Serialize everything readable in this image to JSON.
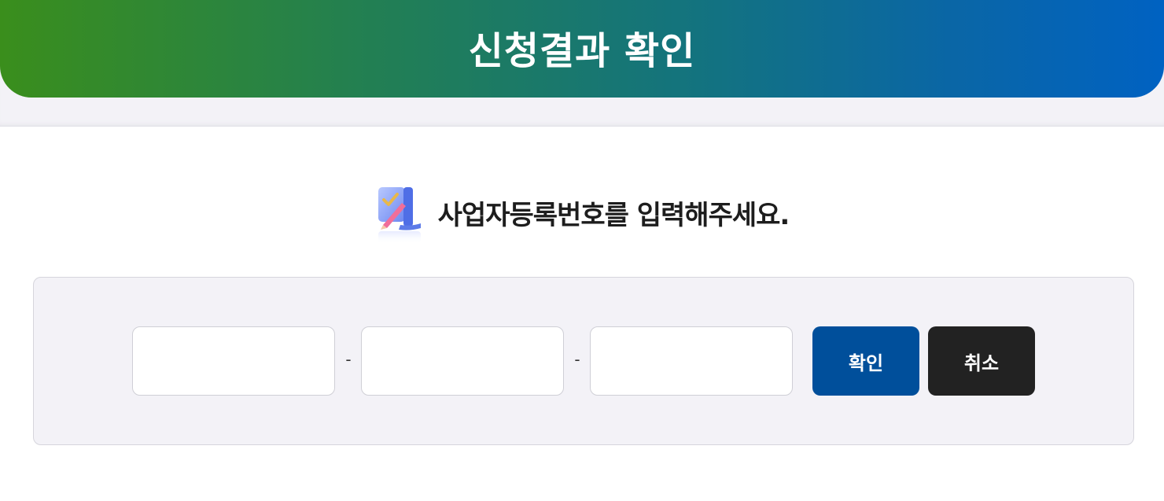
{
  "header": {
    "title": "신청결과 확인"
  },
  "instruction": {
    "text": "사업자등록번호를 입력해주세요.",
    "icon": "pencil-check-icon"
  },
  "form": {
    "inputs": [
      {
        "value": "",
        "placeholder": ""
      },
      {
        "value": "",
        "placeholder": ""
      },
      {
        "value": "",
        "placeholder": ""
      }
    ],
    "separator": "-",
    "confirm_label": "확인",
    "cancel_label": "취소"
  },
  "colors": {
    "header_gradient_start": "#3a8e1c",
    "header_gradient_end": "#0062c2",
    "confirm_button": "#004f9b",
    "cancel_button": "#222222",
    "panel_bg": "#f3f2f7"
  }
}
